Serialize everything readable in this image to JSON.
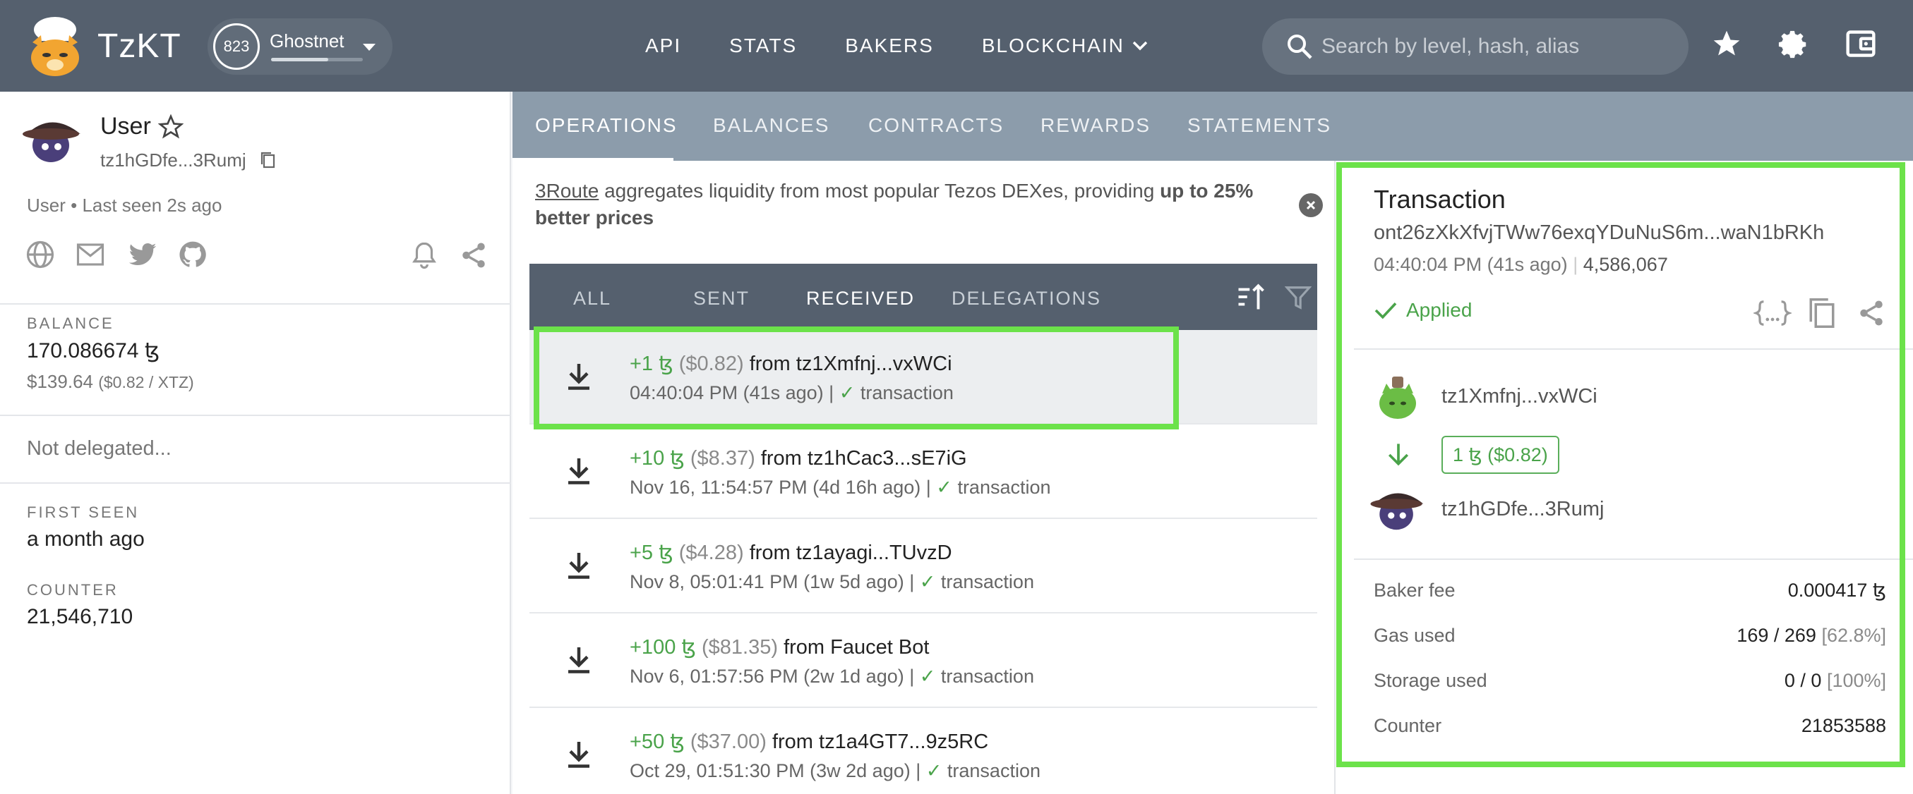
{
  "header": {
    "brand": "TzKT",
    "network": {
      "name": "Ghostnet",
      "cycle": "823",
      "progress": 0.62
    },
    "nav": [
      "API",
      "STATS",
      "BAKERS",
      "BLOCKCHAIN"
    ],
    "search_placeholder": "Search by level, hash, alias",
    "icons": [
      "star-icon",
      "gear-icon",
      "wallet-icon"
    ]
  },
  "account": {
    "name": "User",
    "address": "tz1hGDfe...3Rumj",
    "meta": "User • Last seen 2s ago",
    "social_icons": [
      "globe-icon",
      "mail-icon",
      "twitter-icon",
      "github-icon"
    ],
    "balance_label": "BALANCE",
    "balance": "170.086674 ꜩ",
    "balance_usd": "$139.64",
    "rate": "($0.82 / XTZ)",
    "delegation": "Not delegated...",
    "first_seen_label": "FIRST SEEN",
    "first_seen": "a month ago",
    "counter_label": "COUNTER",
    "counter": "21,546,710"
  },
  "tabs": [
    "OPERATIONS",
    "BALANCES",
    "CONTRACTS",
    "REWARDS",
    "STATEMENTS"
  ],
  "promo": {
    "link": "3Route",
    "text": " aggregates liquidity from most popular Tezos DEXes, providing ",
    "bold": "up to 25% better prices"
  },
  "filters": [
    "ALL",
    "SENT",
    "RECEIVED",
    "DELEGATIONS"
  ],
  "operations": [
    {
      "amount": "+1 ꜩ",
      "usd": "($0.82)",
      "from": "from",
      "sender": "tz1Xmfnj...vxWCi",
      "time": "04:40:04 PM (41s ago) |",
      "type": "transaction"
    },
    {
      "amount": "+10 ꜩ",
      "usd": "($8.37)",
      "from": "from",
      "sender": "tz1hCac3...sE7iG",
      "time": "Nov 16, 11:54:57 PM (4d 16h ago) |",
      "type": "transaction"
    },
    {
      "amount": "+5 ꜩ",
      "usd": "($4.28)",
      "from": "from",
      "sender": "tz1ayagi...TUvzD",
      "time": "Nov 8, 05:01:41 PM (1w 5d ago) |",
      "type": "transaction"
    },
    {
      "amount": "+100 ꜩ",
      "usd": "($81.35)",
      "from": "from",
      "sender": "Faucet Bot",
      "time": "Nov 6, 01:57:56 PM (2w 1d ago) |",
      "type": "transaction"
    },
    {
      "amount": "+50 ꜩ",
      "usd": "($37.00)",
      "from": "from",
      "sender": "tz1a4GT7...9z5RC",
      "time": "Oct 29, 01:51:30 PM (3w 2d ago) |",
      "type": "transaction"
    }
  ],
  "transaction": {
    "title": "Transaction",
    "hash": "ont26zXkXfvjTWw76exqYDuNuS6m...waN1bRKh",
    "time": "04:40:04 PM (41s ago)",
    "level": "4,586,067",
    "status": "Applied",
    "sender": "tz1Xmfnj...vxWCi",
    "amount": "1 ꜩ ($0.82)",
    "target": "tz1hGDfe...3Rumj",
    "fields": [
      {
        "k": "Baker fee",
        "v": "0.000417 ꜩ"
      },
      {
        "k": "Gas used",
        "v": "169 / 269",
        "extra": "[62.8%]"
      },
      {
        "k": "Storage used",
        "v": "0 / 0",
        "extra": "[100%]"
      },
      {
        "k": "Counter",
        "v": "21853588"
      }
    ]
  },
  "colors": {
    "topbar": "#55606e",
    "tabband": "#8c9cab",
    "accent_green": "#4aa34a",
    "highlight": "#6ce24a"
  }
}
